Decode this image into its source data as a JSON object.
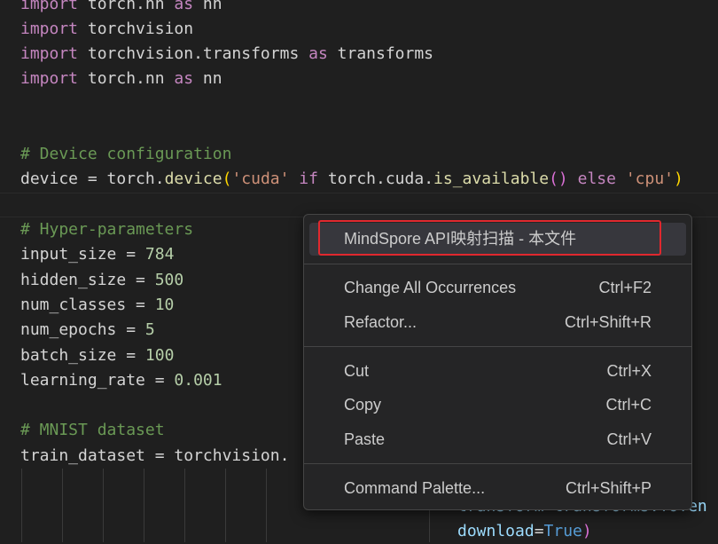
{
  "code": {
    "l1": {
      "kw1": "import",
      "mod": " torch.nn ",
      "kw2": "as",
      "alias": " nn"
    },
    "l2": {
      "kw1": "import",
      "mod": " torchvision"
    },
    "l3": {
      "kw1": "import",
      "mod": " torchvision.transforms ",
      "kw2": "as",
      "alias": " transforms"
    },
    "l4": {
      "kw1": "import",
      "mod": " torch.nn ",
      "kw2": "as",
      "alias": " nn"
    },
    "comment_device": "# Device configuration",
    "device": {
      "a": "device = torch.",
      "fn": "device",
      "ob": "(",
      "s1": "'cuda'",
      "k1": " if ",
      "b": "torch.cuda.",
      "fn2": "is_available",
      "p": "()",
      "k2": " else ",
      "s2": "'cpu'",
      "cb": ")"
    },
    "comment_hyper": "# Hyper-parameters",
    "input_size": {
      "a": "input_size = ",
      "v": "784"
    },
    "hidden_size": {
      "a": "hidden_size = ",
      "v": "500"
    },
    "num_classes": {
      "a": "num_classes = ",
      "v": "10"
    },
    "num_epochs": {
      "a": "num_epochs = ",
      "v": "5"
    },
    "batch_size": {
      "a": "batch_size = ",
      "v": "100"
    },
    "learning_rate": {
      "a": "learning_rate = ",
      "v": "0.001"
    },
    "comment_mnist": "# MNIST dataset",
    "train_dataset": "train_dataset = torchvision.",
    "transform_partial": "transform=transforms.ToTen",
    "download": {
      "p": "download",
      "eq": "=",
      "v": "True",
      "cb": ")"
    }
  },
  "context_menu": {
    "items": [
      {
        "label": "MindSpore API映射扫描 - 本文件",
        "shortcut": ""
      },
      {
        "label": "Change All Occurrences",
        "shortcut": "Ctrl+F2"
      },
      {
        "label": "Refactor...",
        "shortcut": "Ctrl+Shift+R"
      },
      {
        "label": "Cut",
        "shortcut": "Ctrl+X"
      },
      {
        "label": "Copy",
        "shortcut": "Ctrl+C"
      },
      {
        "label": "Paste",
        "shortcut": "Ctrl+V"
      },
      {
        "label": "Command Palette...",
        "shortcut": "Ctrl+Shift+P"
      }
    ]
  },
  "colors": {
    "background": "#1f1f1f",
    "keyword": "#c586c0",
    "comment": "#6a9955",
    "number": "#b5cea8",
    "string": "#ce9178",
    "highlight_box": "#e0282e"
  }
}
